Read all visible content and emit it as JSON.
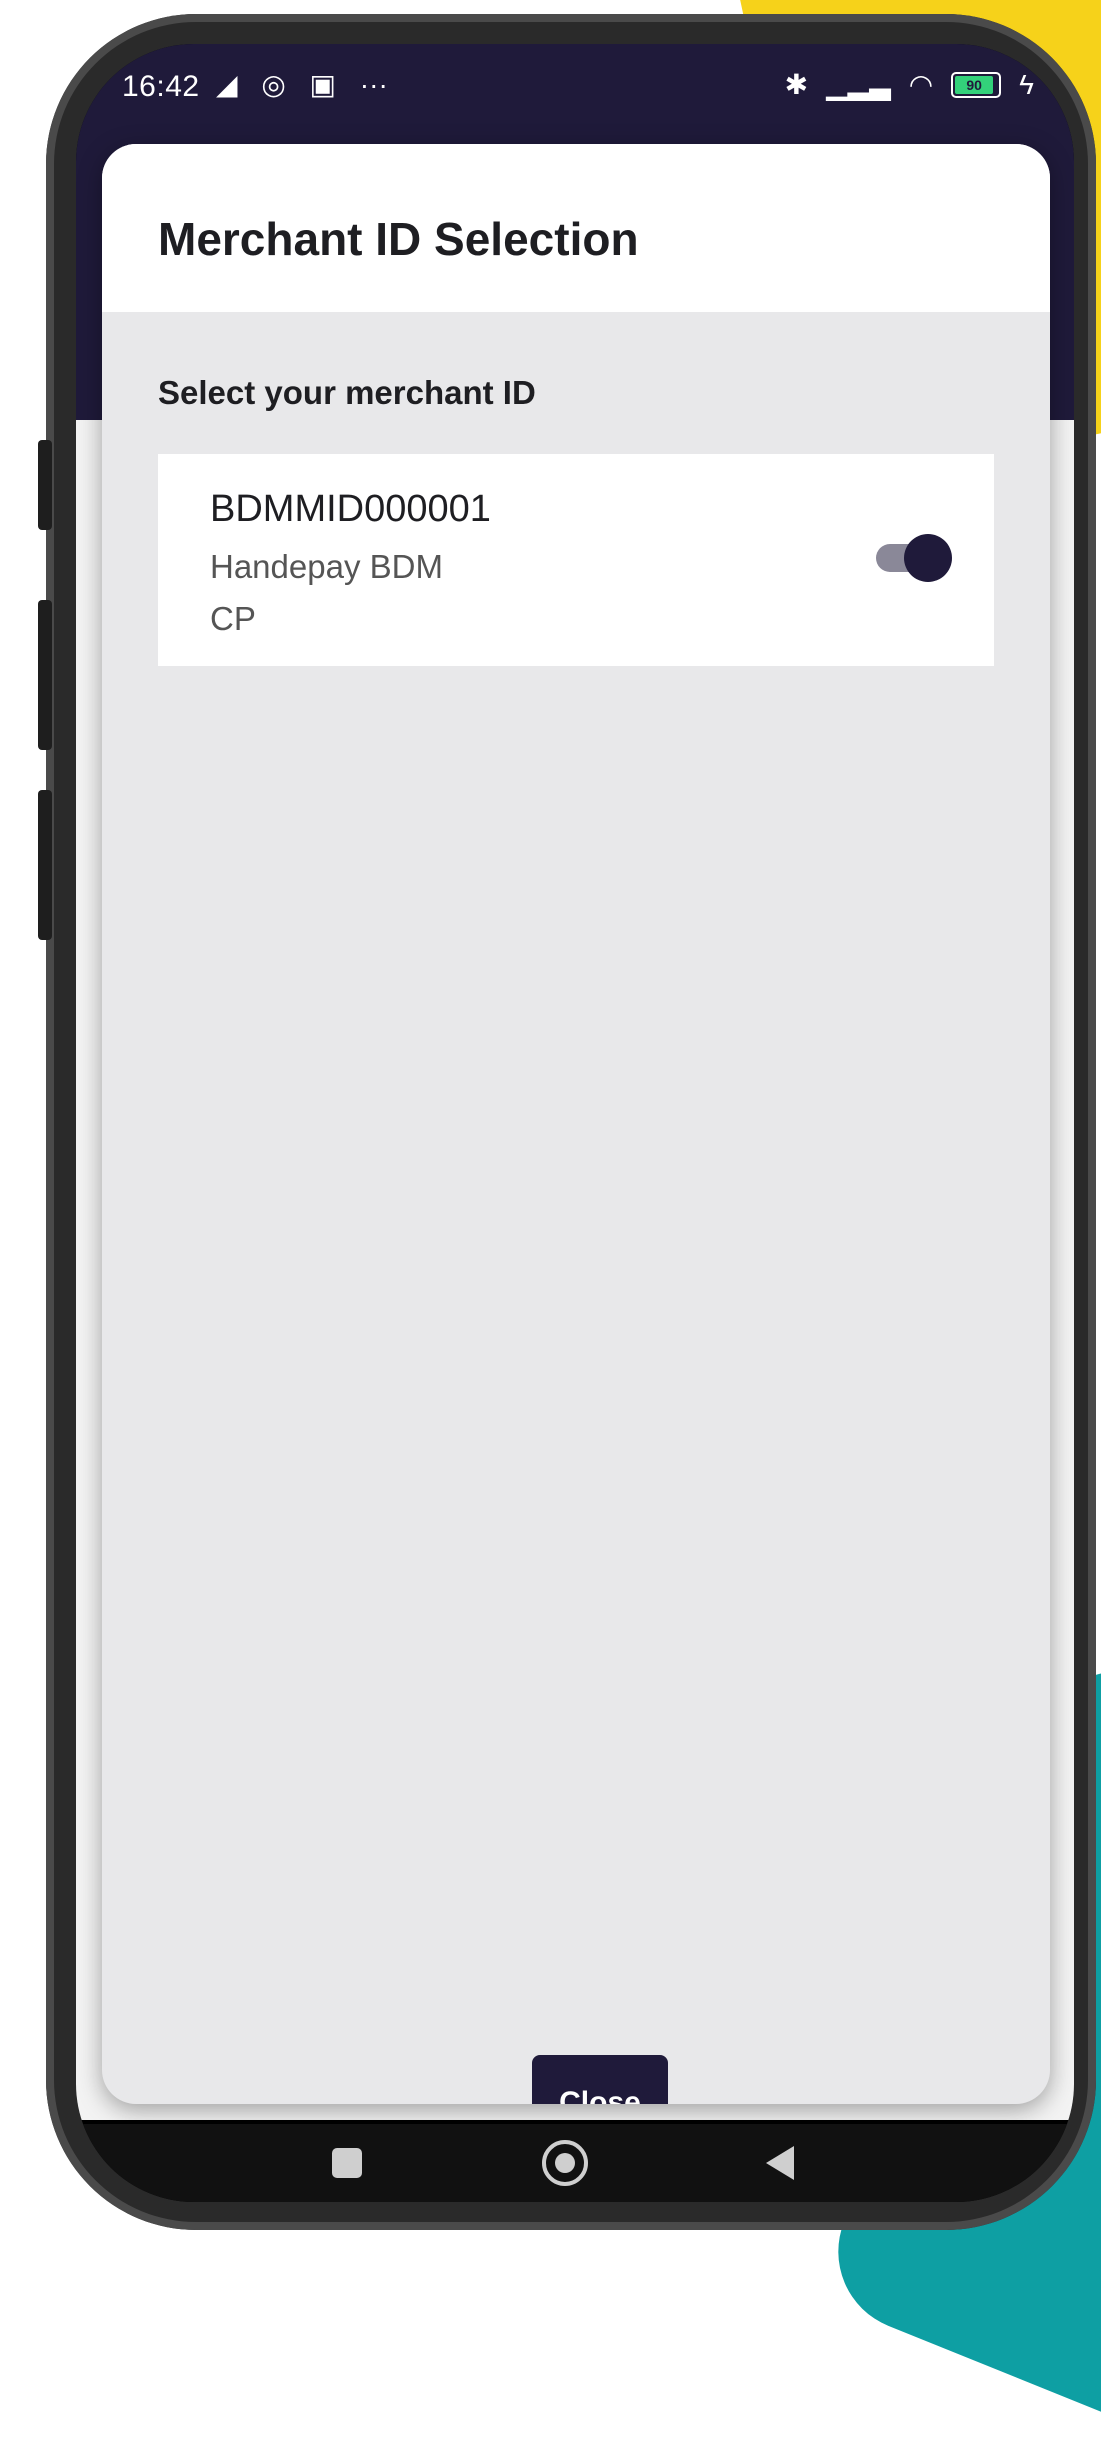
{
  "status_bar": {
    "time": "16:42",
    "left_icons": [
      "telegram-icon",
      "whatsapp-icon",
      "email-icon",
      "more-icon"
    ],
    "right_icons": [
      "bluetooth-icon",
      "signal-icon",
      "wifi-icon",
      "battery-icon",
      "charging-icon"
    ],
    "battery_level": "90"
  },
  "modal": {
    "title": "Merchant ID Selection",
    "subtitle": "Select your merchant ID",
    "merchants": [
      {
        "id": "BDMMID000001",
        "name": "Handepay BDM",
        "type": "CP",
        "selected": true
      }
    ],
    "close_label": "Close"
  },
  "colors": {
    "primary": "#1f1a3a",
    "background": "#e8e8ea",
    "card": "#ffffff",
    "accent_yellow": "#f6d21a",
    "accent_teal": "#0e9fa3"
  }
}
